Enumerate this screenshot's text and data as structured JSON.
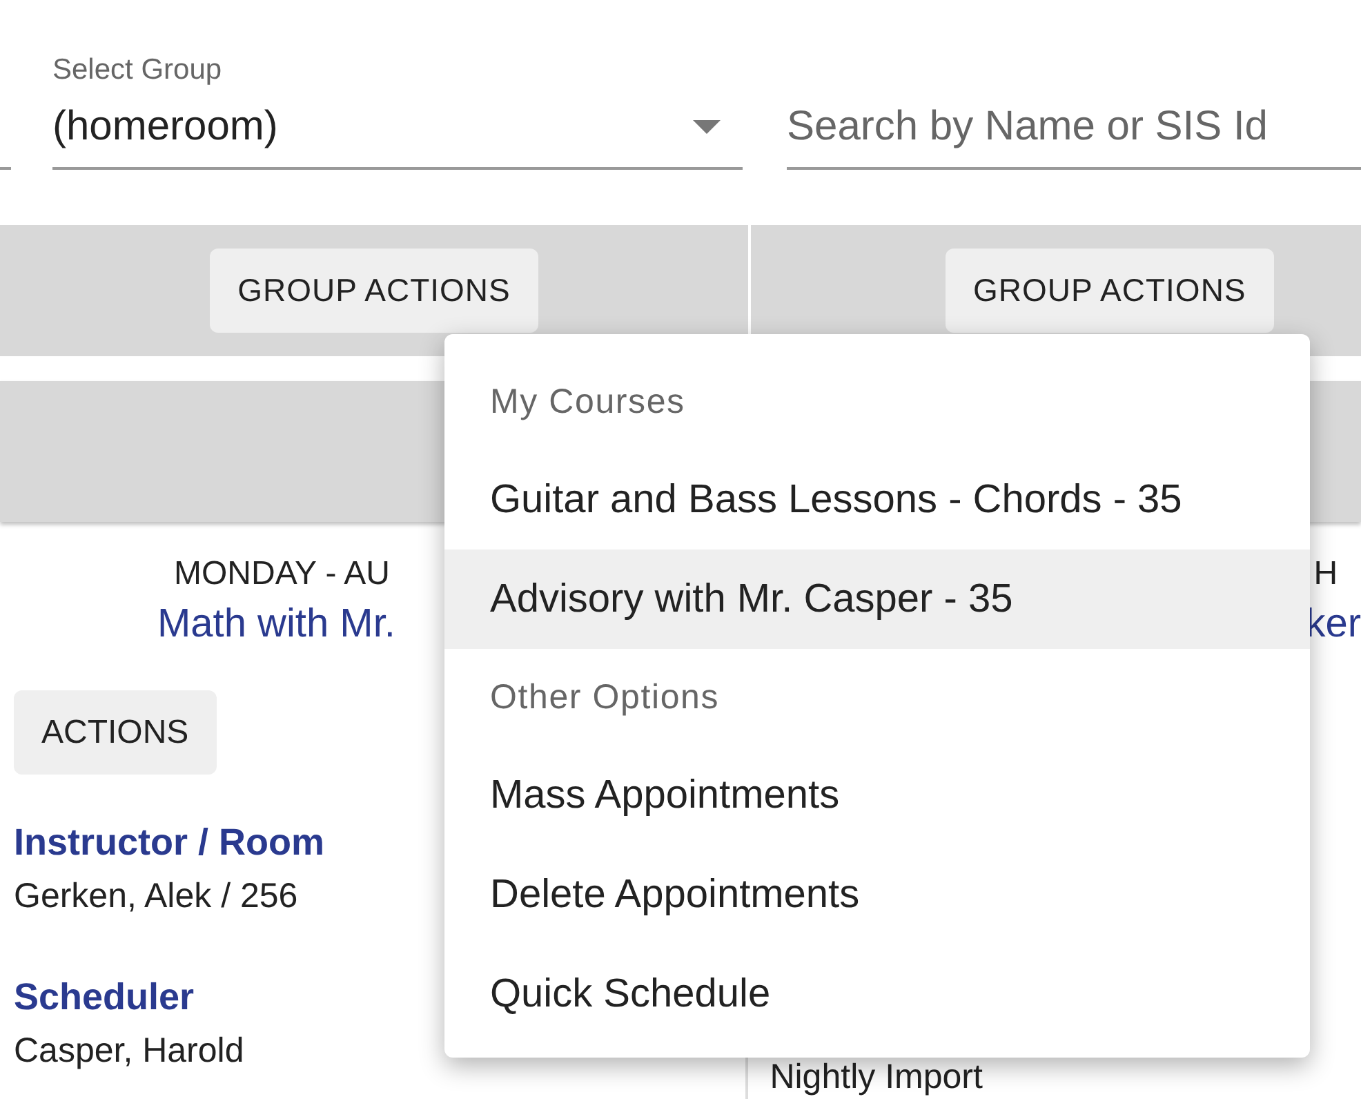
{
  "group_select": {
    "label": "Select Group",
    "value": "(homeroom)"
  },
  "search": {
    "placeholder": "Search by Name or SIS Id"
  },
  "columns": [
    {
      "button": "GROUP ACTIONS",
      "day": "MONDAY - AU",
      "course": "Math with Mr.",
      "actions": "ACTIONS",
      "details": [
        {
          "label": "Instructor / Room",
          "value": "Gerken, Alek / 256"
        },
        {
          "label": "Scheduler",
          "value": "Casper, Harold"
        }
      ]
    },
    {
      "button": "GROUP ACTIONS",
      "day": "H",
      "course": "ker",
      "details": [
        {
          "value": "Nightly Import"
        }
      ]
    }
  ],
  "menu": {
    "items": [
      {
        "kind": "header",
        "label": "My Courses"
      },
      {
        "kind": "option",
        "label": "Guitar and Bass Lessons - Chords - 35",
        "selected": false
      },
      {
        "kind": "option",
        "label": "Advisory with Mr. Casper - 35",
        "selected": true
      },
      {
        "kind": "header",
        "label": "Other Options"
      },
      {
        "kind": "option",
        "label": "Mass Appointments",
        "selected": false
      },
      {
        "kind": "option",
        "label": "Delete Appointments",
        "selected": false
      },
      {
        "kind": "option",
        "label": "Quick Schedule",
        "selected": false
      }
    ]
  }
}
